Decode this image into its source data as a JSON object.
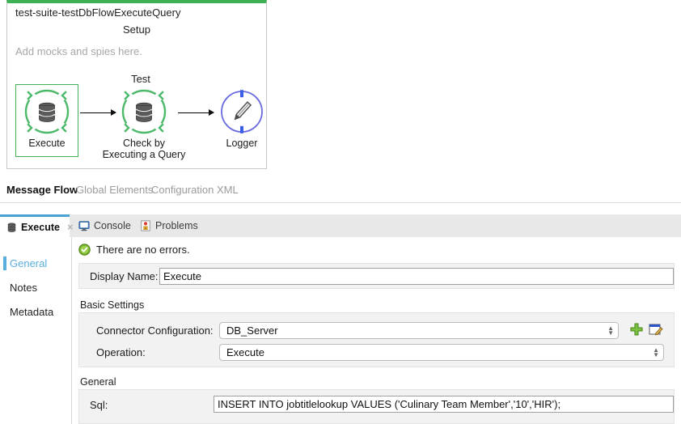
{
  "canvas": {
    "suite_title": "test-suite-testDbFlowExecuteQuery",
    "setup_label": "Setup",
    "mocks_hint": "Add mocks and spies here.",
    "test_label": "Test",
    "accent_green": "#3fb155",
    "accent_blue": "#5b5bd6",
    "nodes": [
      {
        "id": "execute",
        "caption": "Execute",
        "icon": "database-icon",
        "selected": true
      },
      {
        "id": "check-by-executing-a-query",
        "caption": "Check by\nExecuting a Query",
        "caption_line1": "Check by",
        "caption_line2": "Executing a Query",
        "icon": "database-icon",
        "selected": false
      },
      {
        "id": "logger",
        "caption": "Logger",
        "icon": "pencil-icon",
        "selected": false
      }
    ]
  },
  "editor_tabs": [
    {
      "label": "Message Flow",
      "active": true
    },
    {
      "label": "Global Elements",
      "active": false
    },
    {
      "label": "Configuration XML",
      "active": false
    }
  ],
  "view_tabs": [
    {
      "label": "Execute",
      "icon": "database-icon",
      "active": true,
      "closable": true,
      "close_glyph": "×"
    },
    {
      "label": "Console",
      "icon": "console-icon",
      "active": false,
      "closable": false
    },
    {
      "label": "Problems",
      "icon": "problems-icon",
      "active": false,
      "closable": false
    }
  ],
  "properties": {
    "sidebar": {
      "items": [
        {
          "label": "General",
          "selected": true
        },
        {
          "label": "Notes",
          "selected": false
        },
        {
          "label": "Metadata",
          "selected": false
        }
      ],
      "selected_color": "#5aaede"
    },
    "status": {
      "icon": "success-check-icon",
      "text": "There are no errors.",
      "color": "#6aab2b"
    },
    "display_name": {
      "label": "Display Name:",
      "value": "Execute"
    },
    "basic_settings": {
      "title": "Basic Settings",
      "connector_configuration": {
        "label": "Connector Configuration:",
        "value": "DB_Server"
      },
      "operation": {
        "label": "Operation:",
        "value": "Execute"
      },
      "add_button": {
        "icon": "green-plus-icon",
        "title": "Add"
      },
      "edit_button": {
        "icon": "edit-config-icon",
        "title": "Edit"
      }
    },
    "general": {
      "title": "General",
      "sql": {
        "label": "Sql:",
        "value": "INSERT INTO jobtitlelookup VALUES ('Culinary Team Member','10','HIR');"
      }
    }
  }
}
